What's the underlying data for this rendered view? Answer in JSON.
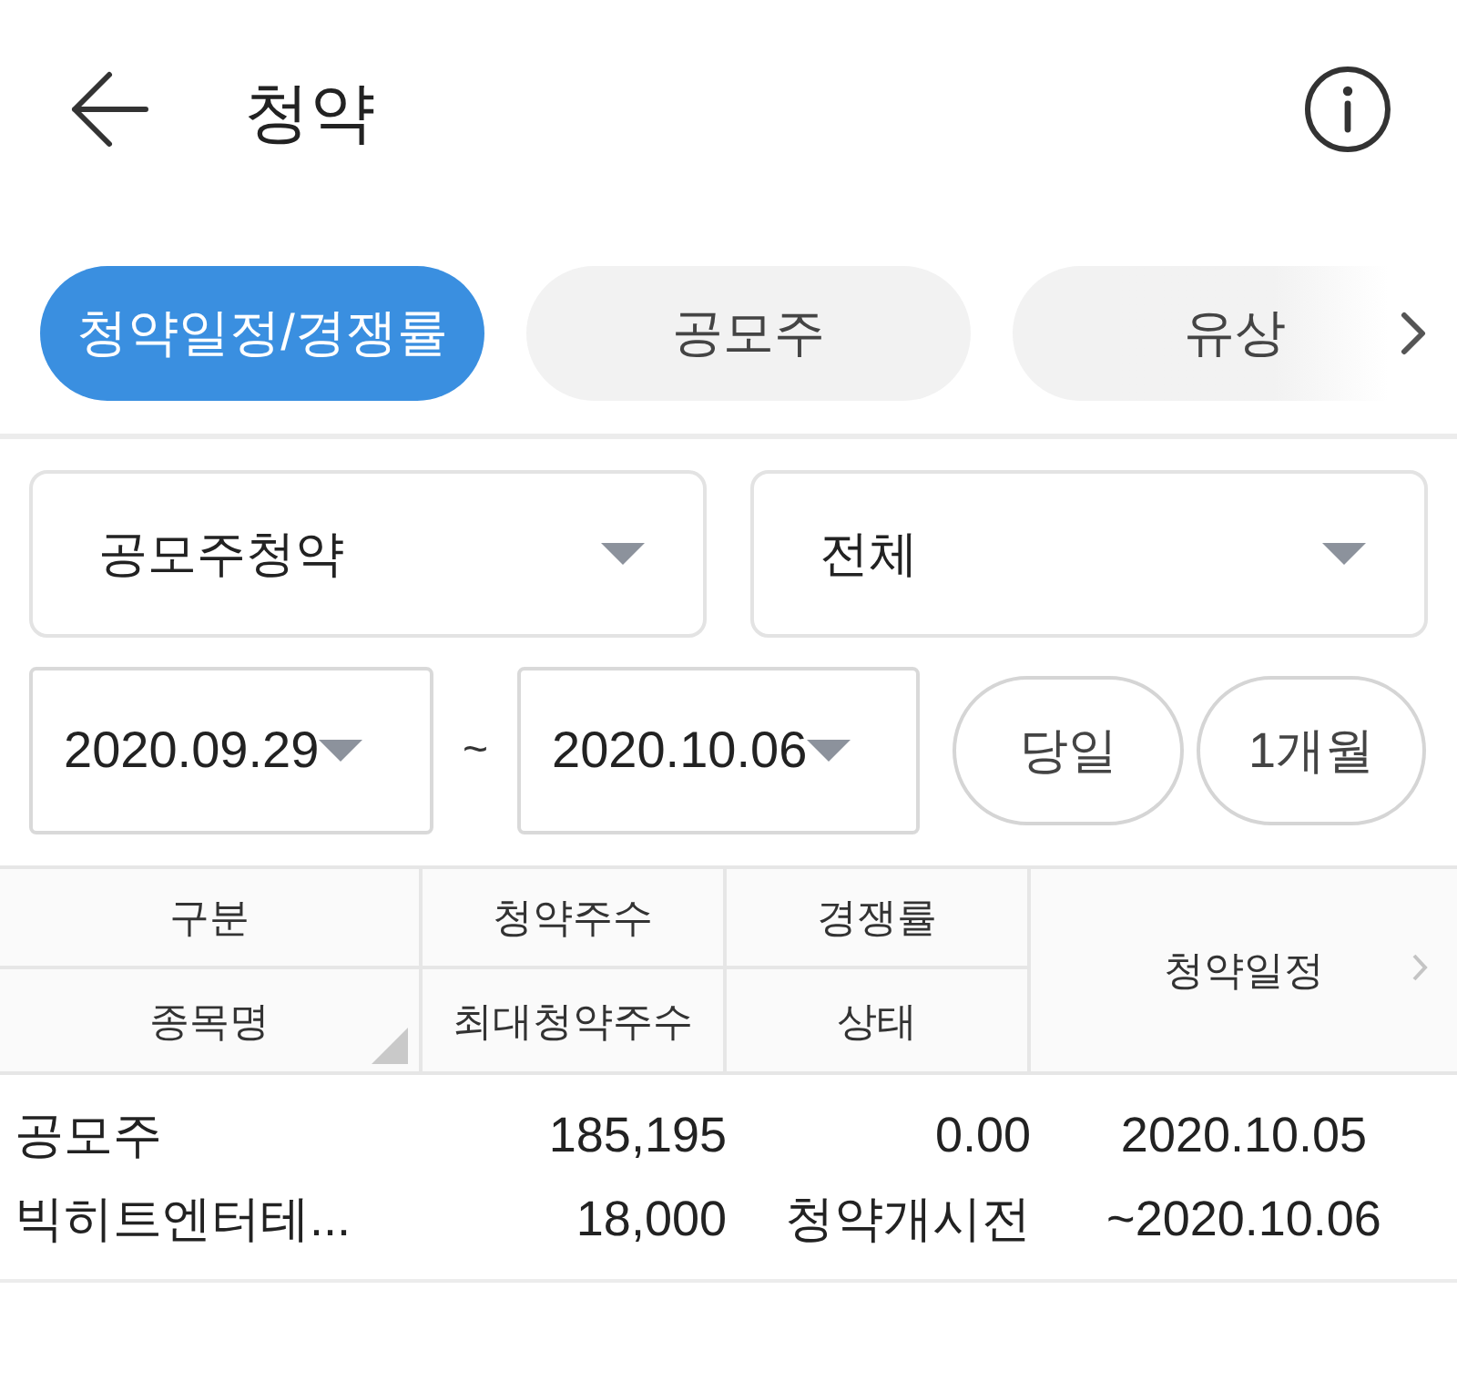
{
  "header": {
    "title": "청약"
  },
  "tabs": [
    {
      "label": "청약일정/경쟁률",
      "selected": true
    },
    {
      "label": "공모주",
      "selected": false
    },
    {
      "label": "유상",
      "selected": false
    }
  ],
  "filters": {
    "dropdowns": [
      {
        "value": "공모주청약"
      },
      {
        "value": "전체"
      }
    ],
    "date_from": "2020.09.29",
    "range_separator": "~",
    "date_to": "2020.10.06",
    "period_buttons": [
      "당일",
      "1개월"
    ]
  },
  "table": {
    "columns": [
      {
        "top": "구분",
        "bottom": "종목명"
      },
      {
        "top": "청약주수",
        "bottom": "최대청약주수"
      },
      {
        "top": "경쟁률",
        "bottom": "상태"
      },
      {
        "label": "청약일정"
      }
    ],
    "rows": [
      {
        "lines": [
          [
            "공모주",
            "185,195",
            "0.00",
            "2020.10.05"
          ],
          [
            "빅히트엔터테...",
            "18,000",
            "청약개시전",
            "~2020.10.06"
          ]
        ]
      }
    ]
  }
}
